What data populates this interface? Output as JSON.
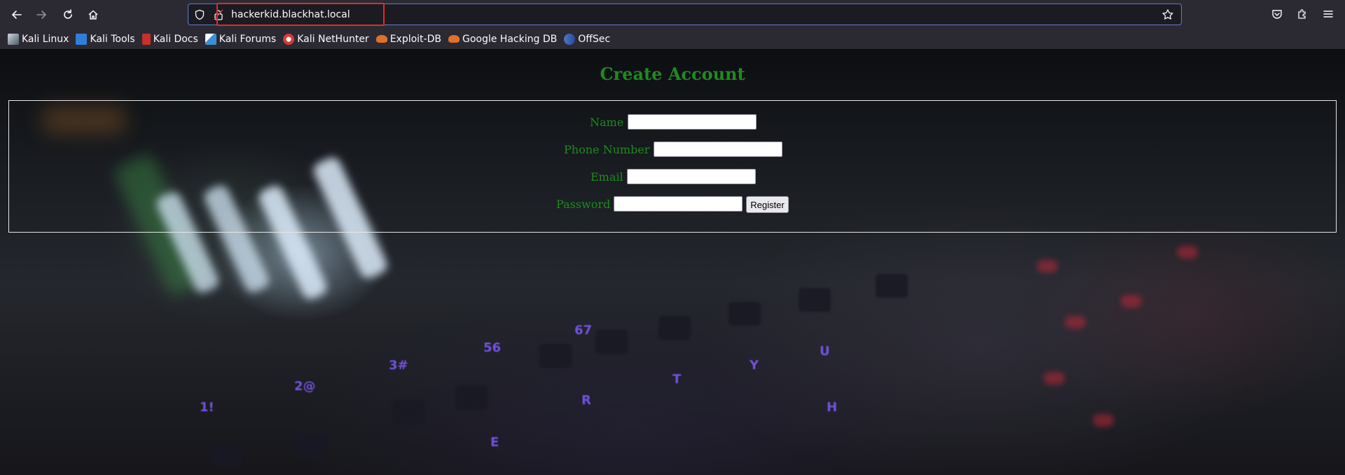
{
  "browser": {
    "url": "hackerkid.blackhat.local",
    "bookmarks": [
      {
        "label": "Kali Linux",
        "icon": "kali-dragon-icon",
        "color": "#9fb8c8"
      },
      {
        "label": "Kali Tools",
        "icon": "kali-tools-icon",
        "color": "#2f7fd8"
      },
      {
        "label": "Kali Docs",
        "icon": "kali-docs-icon",
        "color": "#c8302c"
      },
      {
        "label": "Kali Forums",
        "icon": "kali-forums-icon",
        "color": "#3a8fd8"
      },
      {
        "label": "Kali NetHunter",
        "icon": "kali-nethunter-icon",
        "color": "#d8383a"
      },
      {
        "label": "Exploit-DB",
        "icon": "exploit-db-icon",
        "color": "#e0702a"
      },
      {
        "label": "Google Hacking DB",
        "icon": "ghdb-icon",
        "color": "#e0702a"
      },
      {
        "label": "OffSec",
        "icon": "offsec-icon",
        "color": "#4a78c8"
      }
    ]
  },
  "page": {
    "heading": "Create Account",
    "form": {
      "name_label": "Name",
      "phone_label": "Phone Number",
      "email_label": "Email",
      "password_label": "Password",
      "register_label": "Register",
      "name_value": "",
      "phone_value": "",
      "email_value": "",
      "password_value": ""
    },
    "colors": {
      "label_green": "#1f8a1f",
      "url_highlight": "#e02b2b"
    }
  }
}
